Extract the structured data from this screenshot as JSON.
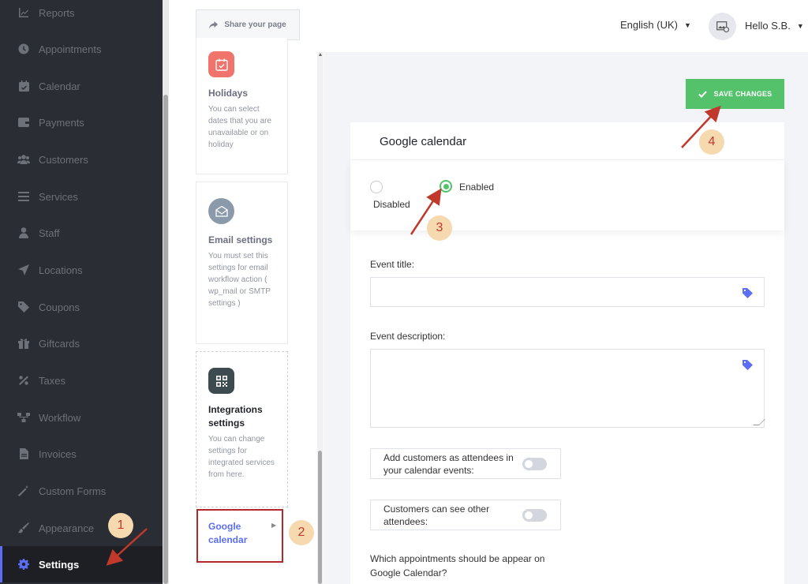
{
  "sidebar": {
    "items": [
      {
        "label": "Reports",
        "icon": "chart-icon"
      },
      {
        "label": "Appointments",
        "icon": "clock-icon"
      },
      {
        "label": "Calendar",
        "icon": "calendar-icon"
      },
      {
        "label": "Payments",
        "icon": "wallet-icon"
      },
      {
        "label": "Customers",
        "icon": "users-icon"
      },
      {
        "label": "Services",
        "icon": "list-icon"
      },
      {
        "label": "Staff",
        "icon": "user-icon"
      },
      {
        "label": "Locations",
        "icon": "location-arrow-icon"
      },
      {
        "label": "Coupons",
        "icon": "tag-icon"
      },
      {
        "label": "Giftcards",
        "icon": "gift-icon"
      },
      {
        "label": "Taxes",
        "icon": "percent-icon"
      },
      {
        "label": "Workflow",
        "icon": "workflow-icon"
      },
      {
        "label": "Invoices",
        "icon": "file-icon"
      },
      {
        "label": "Custom Forms",
        "icon": "wand-icon"
      },
      {
        "label": "Appearance",
        "icon": "brush-icon"
      },
      {
        "label": "Settings",
        "icon": "gear-icon",
        "active": true
      }
    ]
  },
  "topbar": {
    "share_label": "Share your page",
    "language": "English (UK)",
    "user_greeting": "Hello S.B."
  },
  "settings_list": {
    "holidays": {
      "title": "Holidays",
      "desc": "You can select dates that you are unavailable or on holiday"
    },
    "email": {
      "title": "Email settings",
      "desc": "You must set this settings for email workflow action ( wp_mail or SMTP settings )"
    },
    "integrations": {
      "title": "Integrations settings",
      "desc": "You can change settings for integrated services from here."
    },
    "google_calendar": {
      "title": "Google calendar"
    }
  },
  "main": {
    "save_label": "SAVE CHANGES",
    "panel_title": "Google calendar",
    "radio_disabled": "Disabled",
    "radio_enabled": "Enabled",
    "event_title_label": "Event title:",
    "event_description_label": "Event description:",
    "toggle_attendees_label": "Add customers as attendees in your calendar events:",
    "toggle_see_attendees_label": "Customers can see other attendees:",
    "question_text": "Which appointments should be appear on Google Calendar?"
  },
  "annotations": {
    "step1": "1",
    "step2": "2",
    "step3": "3",
    "step4": "4"
  },
  "colors": {
    "accent": "#5b6ef5",
    "success": "#53c26a",
    "sidebar_bg": "#2a2d33",
    "annotation": "#c0392b"
  }
}
